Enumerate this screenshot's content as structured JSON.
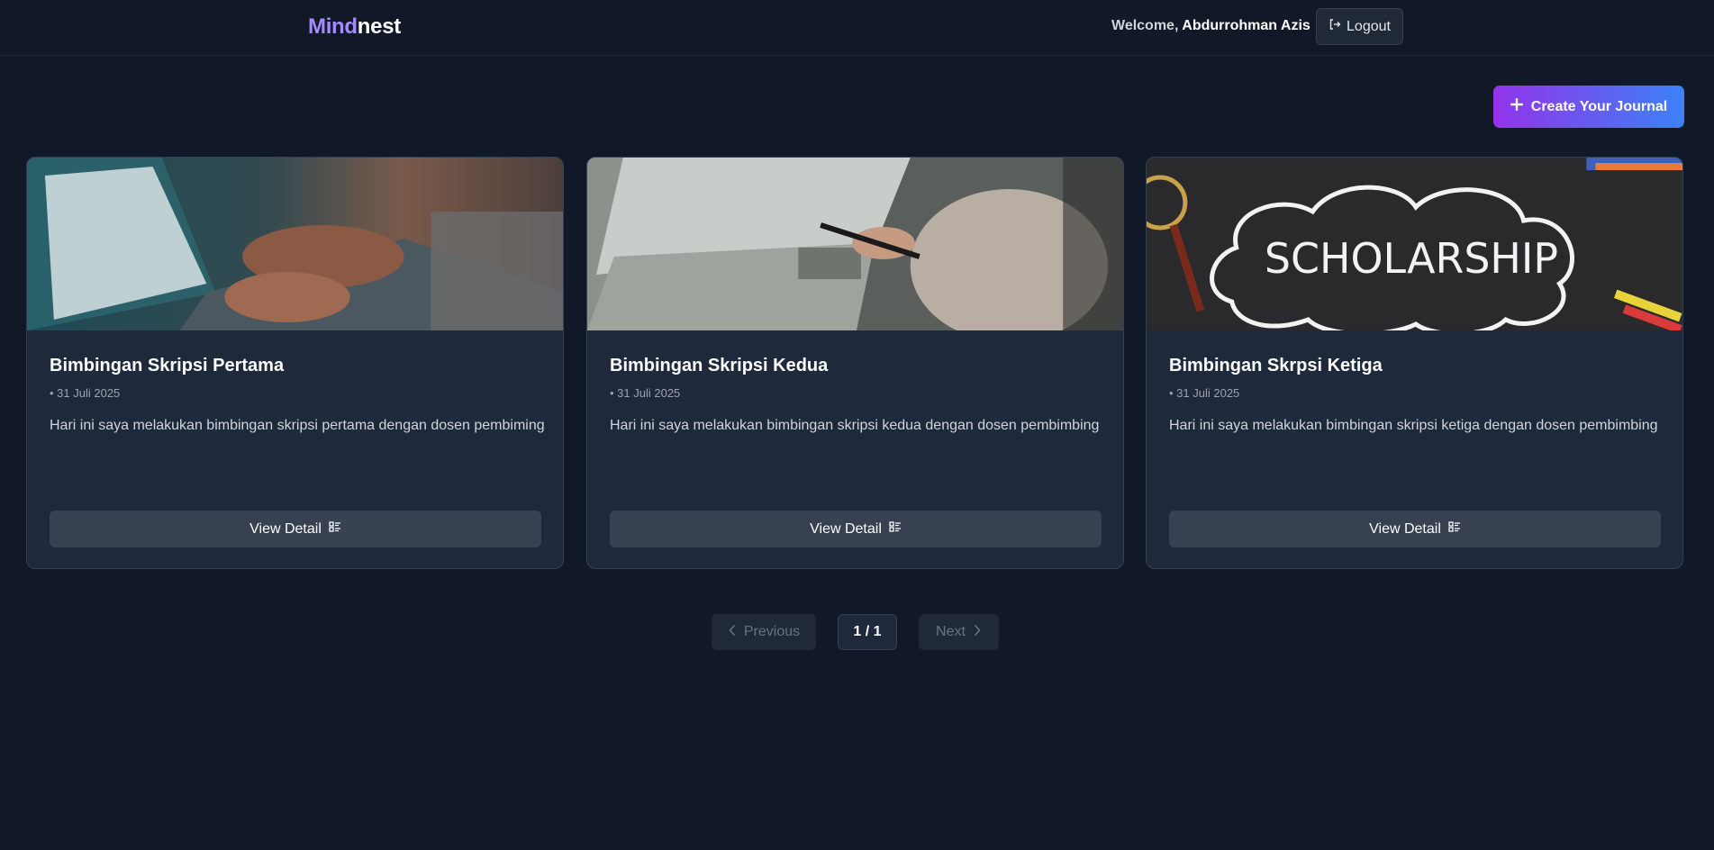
{
  "header": {
    "brand_part1": "Mind",
    "brand_part2": "nest",
    "welcome_prefix": "Welcome,",
    "user_name": "Abdurrohman Azis",
    "logout_label": "Logout"
  },
  "actions": {
    "create_label": "Create Your Journal"
  },
  "journals": [
    {
      "title": "Bimbingan Skripsi Pertama",
      "date": "• 31 Juli 2025",
      "description": "Hari ini saya melakukan bimbingan skripsi pertama dengan dosen pembiming",
      "button_label": "View Detail"
    },
    {
      "title": "Bimbingan Skripsi Kedua",
      "date": "• 31 Juli 2025",
      "description": "Hari ini saya melakukan bimbingan skripsi kedua dengan dosen pembimbing",
      "button_label": "View Detail"
    },
    {
      "title": "Bimbingan Skrpsi Ketiga",
      "date": "• 31 Juli 2025",
      "description": "Hari ini saya melakukan bimbingan skripsi ketiga dengan dosen pembimbing",
      "button_label": "View Detail",
      "image_text": "SCHOLARSHIP"
    }
  ],
  "pagination": {
    "previous_label": "Previous",
    "current": "1 / 1",
    "next_label": "Next"
  },
  "colors": {
    "background": "#111827",
    "card": "#1e293b",
    "brand_accent": "#a78bfa",
    "gradient_start": "#9333ea",
    "gradient_end": "#3b82f6"
  }
}
